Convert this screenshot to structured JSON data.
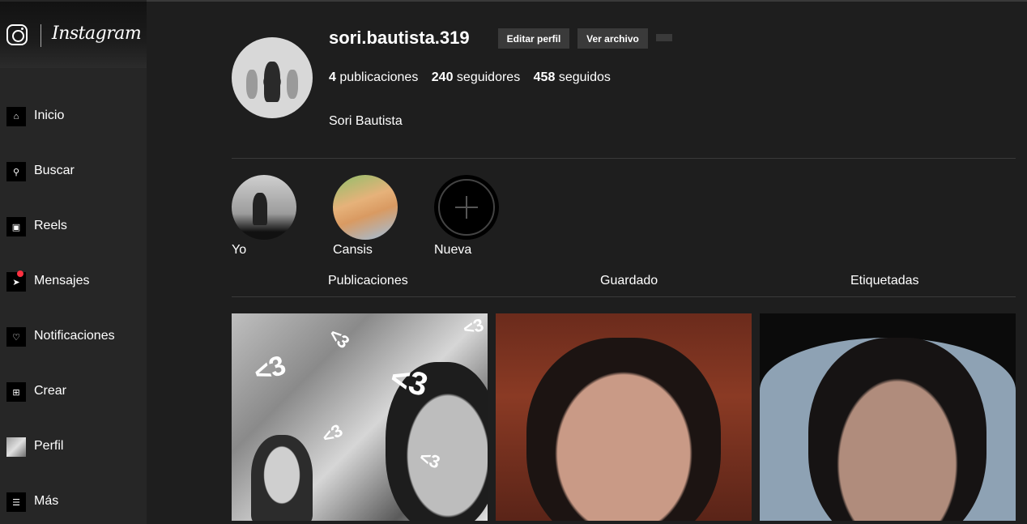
{
  "brand": {
    "name": "Instagram"
  },
  "sidebar": {
    "items": [
      {
        "label": "Inicio",
        "icon": "home-icon"
      },
      {
        "label": "Buscar",
        "icon": "search-icon"
      },
      {
        "label": "Reels",
        "icon": "reels-icon"
      },
      {
        "label": "Mensajes",
        "icon": "messages-icon",
        "has_notification": true
      },
      {
        "label": "Notificaciones",
        "icon": "heart-icon"
      },
      {
        "label": "Crear",
        "icon": "plus-square-icon"
      },
      {
        "label": "Perfil",
        "icon": "profile-thumbnail"
      },
      {
        "label": "Más",
        "icon": "menu-icon"
      }
    ]
  },
  "profile": {
    "username": "sori.bautista.319",
    "edit_label": "Editar perfil",
    "archive_label": "Ver archivo",
    "posts_count": "4",
    "posts_label": "publicaciones",
    "followers_count": "240",
    "followers_label": "seguidores",
    "following_count": "458",
    "following_label": "seguidos",
    "full_name": "Sori Bautista"
  },
  "highlights": [
    {
      "label": "Yo"
    },
    {
      "label": "Cansis"
    },
    {
      "label": "Nueva"
    }
  ],
  "tabs": [
    {
      "label": "Publicaciones"
    },
    {
      "label": "Guardado"
    },
    {
      "label": "Etiquetadas"
    }
  ],
  "colors": {
    "background": "#1e1e1e",
    "sidebar": "#262626",
    "button": "#3a3a3a",
    "notification": "#ff3040"
  }
}
